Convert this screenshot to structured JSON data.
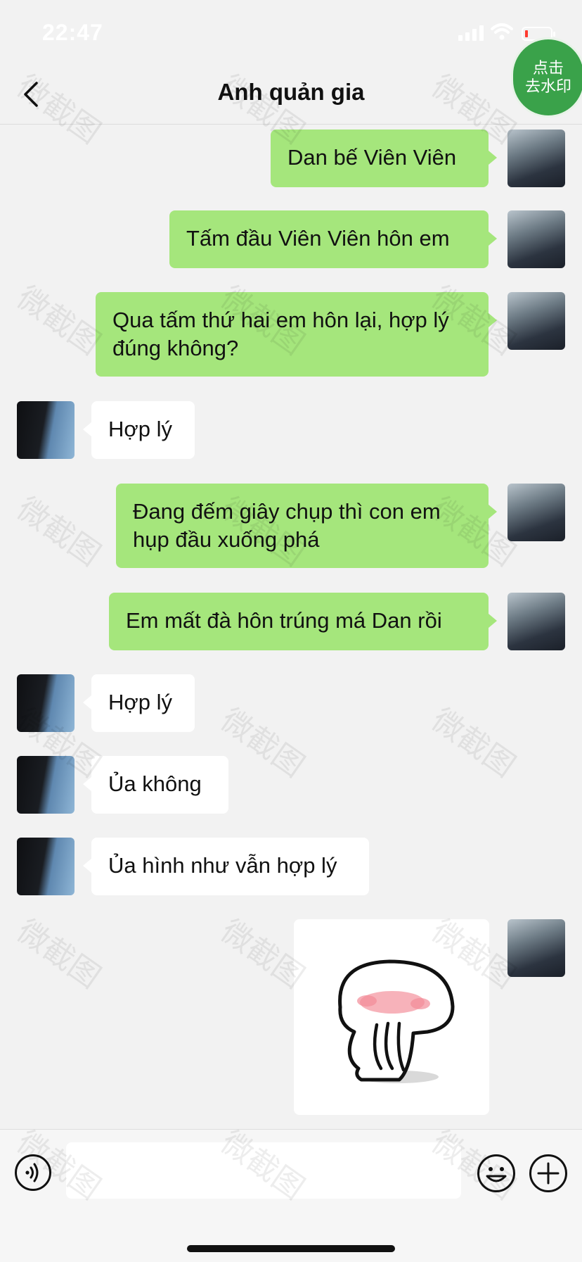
{
  "status_bar": {
    "time": "22:47"
  },
  "nav": {
    "title": "Anh quản gia",
    "watermark_button_line1": "点击",
    "watermark_button_line2": "去水印"
  },
  "messages": [
    {
      "side": "me",
      "text": "Dan bế Viên Viên"
    },
    {
      "side": "me",
      "text": "Tấm đầu Viên Viên hôn em"
    },
    {
      "side": "me",
      "text": "Qua tấm thứ hai em hôn lại, hợp lý đúng không?"
    },
    {
      "side": "other",
      "text": "Hợp lý"
    },
    {
      "side": "me",
      "text": "Đang đếm giây chụp thì con em hụp đầu xuống phá"
    },
    {
      "side": "me",
      "text": "Em mất đà hôn trúng má Dan rồi"
    },
    {
      "side": "other",
      "text": "Hợp lý"
    },
    {
      "side": "other",
      "text": "Ủa không"
    },
    {
      "side": "other",
      "text": "Ủa hình như vẫn hợp lý"
    },
    {
      "side": "me",
      "type": "sticker",
      "icon": "blushing-bun-sticker"
    }
  ],
  "input": {
    "value": "",
    "placeholder": ""
  },
  "icons": {
    "back": "chevron-left-icon",
    "voice": "voice-icon",
    "emoji": "emoji-icon",
    "plus": "plus-icon"
  },
  "watermark": {
    "text": "微截图"
  },
  "colors": {
    "my_bubble": "#a5e67c",
    "other_bubble": "#ffffff",
    "background": "#f2f2f2",
    "watermark_button": "#3aa24a"
  }
}
